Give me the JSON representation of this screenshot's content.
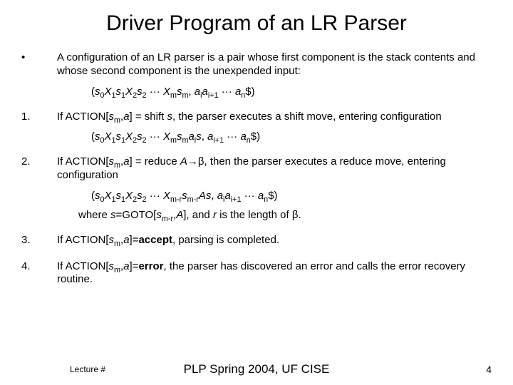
{
  "title": "Driver Program of an LR Parser",
  "bullet": {
    "marker": "•",
    "text": "A configuration of an LR parser is a pair whose first component is the stack contents and whose second component is the unexpended input:"
  },
  "formula0": {
    "open": "(",
    "s0": "s",
    "s0sub": "0",
    "x1": "X",
    "x1sub": "1",
    "s1": "s",
    "s1sub": "1",
    "x2": "X",
    "x2sub": "2",
    "s2": "s",
    "s2sub": "2",
    "dots": " ··· ",
    "xm": "X",
    "xmsub": "m",
    "sm": "s",
    "smsub": "m",
    "comma1": ", ",
    "ai": "a",
    "aisub": "i",
    "ai1": "a",
    "ai1sub": "i+1",
    "dots2": " ··· ",
    "an": "a",
    "ansub": "n",
    "dollar": "$",
    "close": ")"
  },
  "item1": {
    "marker": "1.",
    "pre": "If ACTION[",
    "sm": "s",
    "smsub": "m",
    "mid": ",",
    "a": "a",
    "post1": "] = shift ",
    "s": "s",
    "post2": ", the parser executes a shift move, entering configuration"
  },
  "formula1": {
    "open": "(",
    "s0": "s",
    "s0sub": "0",
    "x1": "X",
    "x1sub": "1",
    "s1": "s",
    "s1sub": "1",
    "x2": "X",
    "x2sub": "2",
    "s2": "s",
    "s2sub": "2",
    "dots": " ··· ",
    "xm": "X",
    "xmsub": "m",
    "sm": "s",
    "smsub": "m",
    "ai": "a",
    "aisub": "i",
    "s": "s",
    "comma": ", ",
    "ai1": "a",
    "ai1sub": "i+1",
    "dots2": " ··· ",
    "an": "a",
    "ansub": "n",
    "dollar": "$",
    "close": ")"
  },
  "item2": {
    "marker": "2.",
    "pre": "If ACTION[",
    "sm": "s",
    "smsub": "m",
    "mid": ",",
    "a": "a",
    "post1": "] = reduce ",
    "A": "A",
    "arrow": "→",
    "beta": "β",
    "post2": ", then the parser executes a reduce move, entering configuration"
  },
  "formula2": {
    "open": "(",
    "s0": "s",
    "s0sub": "0",
    "x1": "X",
    "x1sub": "1",
    "s1": "s",
    "s1sub": "1",
    "x2": "X",
    "x2sub": "2",
    "s2": "s",
    "s2sub": "2",
    "dots": " ··· ",
    "xmr": "X",
    "xmrsub": "m-r",
    "smr": "s",
    "smrsub": "m-r",
    "A": "A",
    "s": "s",
    "comma": ", ",
    "ai": "a",
    "aisub": "i",
    "ai1": "a",
    "ai1sub": "i+1",
    "dots2": " ··· ",
    "an": "a",
    "ansub": "n",
    "dollar": "$",
    "close": ")"
  },
  "note2": {
    "pre": "where ",
    "s": "s",
    "eq": "=GOTO[",
    "smr": "s",
    "smrsub": "m-r",
    "comma": ",",
    "A": "A",
    "mid": "], and ",
    "r": "r",
    "post": " is the length of ",
    "beta": "β",
    "dot": "."
  },
  "item3": {
    "marker": "3.",
    "pre": "If ACTION[",
    "sm": "s",
    "smsub": "m",
    "mid": ",",
    "a": "a",
    "post1": "]=",
    "accept": "accept",
    "post2": ", parsing is completed."
  },
  "item4": {
    "marker": "4.",
    "pre": "If ACTION[",
    "sm": "s",
    "smsub": "m",
    "mid": ",",
    "a": "a",
    "post1": "]=",
    "error": "error",
    "post2": ", the parser has discovered an error and calls the error recovery routine."
  },
  "footer": {
    "lecture": "Lecture #",
    "center": "PLP Spring 2004, UF CISE",
    "page": "4"
  }
}
